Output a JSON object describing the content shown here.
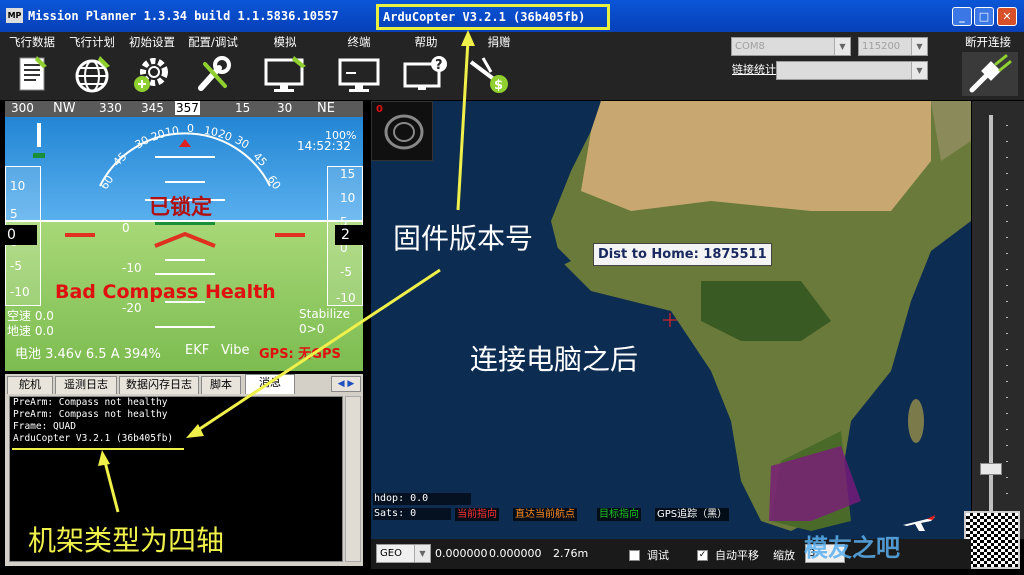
{
  "titlebar": {
    "app_icon": "MP",
    "title": "Mission Planner 1.3.34 build 1.1.5836.10557",
    "version": "ArduCopter V3.2.1 (36b405fb)"
  },
  "menu": [
    {
      "label": "飞行数据",
      "icon": "flight-data-icon"
    },
    {
      "label": "飞行计划",
      "icon": "flight-plan-icon"
    },
    {
      "label": "初始设置",
      "icon": "initial-setup-icon"
    },
    {
      "label": "配置/调试",
      "icon": "config-tuning-icon"
    },
    {
      "label": "模拟",
      "icon": "simulation-icon"
    },
    {
      "label": "终端",
      "icon": "terminal-icon"
    },
    {
      "label": "帮助",
      "icon": "help-icon"
    },
    {
      "label": "捐赠",
      "icon": "donate-icon"
    }
  ],
  "connection": {
    "port": "COM8",
    "baud": "115200",
    "link_stats": "链接统计",
    "disconnect_label": "断开连接"
  },
  "hud": {
    "heading_ticks": [
      "300",
      "NW",
      "330",
      "345",
      "357",
      "15",
      "30",
      "NE"
    ],
    "battery_pct": "100%",
    "time": "14:52:32",
    "status_disarmed": "已锁定",
    "warning": "Bad Compass Health",
    "mode": "Stabilize",
    "airspeed_label": "空速 0.0",
    "groundspeed_label": "地速 0.0",
    "wp": "0>0",
    "left_value": "0",
    "right_value": "2",
    "battery_line": "电池 3.46v 6.5 A 394%",
    "ekf": "EKF",
    "vibe": "Vibe",
    "gps": "GPS: 无GPS",
    "left_tape": [
      "10",
      "5",
      "0",
      "-5",
      "-10"
    ],
    "right_tape": [
      "15",
      "10",
      "5",
      "0",
      "-5",
      "-10"
    ],
    "pitch_labels": [
      "0",
      "-10",
      "-20"
    ],
    "roll_labels": [
      "60",
      "45",
      "30",
      "20",
      "10",
      "0",
      "10",
      "20",
      "30",
      "45",
      "60"
    ]
  },
  "tabs": [
    "舵机",
    "遥测日志",
    "数据闪存日志",
    "脚本",
    "消息"
  ],
  "messages": [
    "PreArm: Compass not healthy",
    "PreArm: Compass not healthy",
    "Frame: QUAD",
    "ArduCopter V3.2.1 (36b405fb)"
  ],
  "map": {
    "dist_to_home": "Dist to Home: 1875511",
    "hdop": "hdop: 0.0",
    "sats": "Sats: 0",
    "legend": [
      {
        "label": "当前指向",
        "color": "#ff2020"
      },
      {
        "label": "直达当前航点",
        "color": "#ff8a20"
      },
      {
        "label": "目标指向",
        "color": "#20c020"
      },
      {
        "label": "GPS追踪（黑）",
        "color": "#ffffff"
      }
    ],
    "altitude_badge": "0"
  },
  "bottombar": {
    "map_type": "GEO",
    "lat": "0.000000",
    "lng": "0.000000",
    "dist": "2.76m",
    "debug_label": "调试",
    "autopan_label": "自动平移",
    "zoom_label": "缩放",
    "zoom_value": "3."
  },
  "annotations": {
    "firmware": "固件版本号",
    "after_connect": "连接电脑之后",
    "frame_type": "机架类型为四轴"
  },
  "watermark": "模友之吧"
}
